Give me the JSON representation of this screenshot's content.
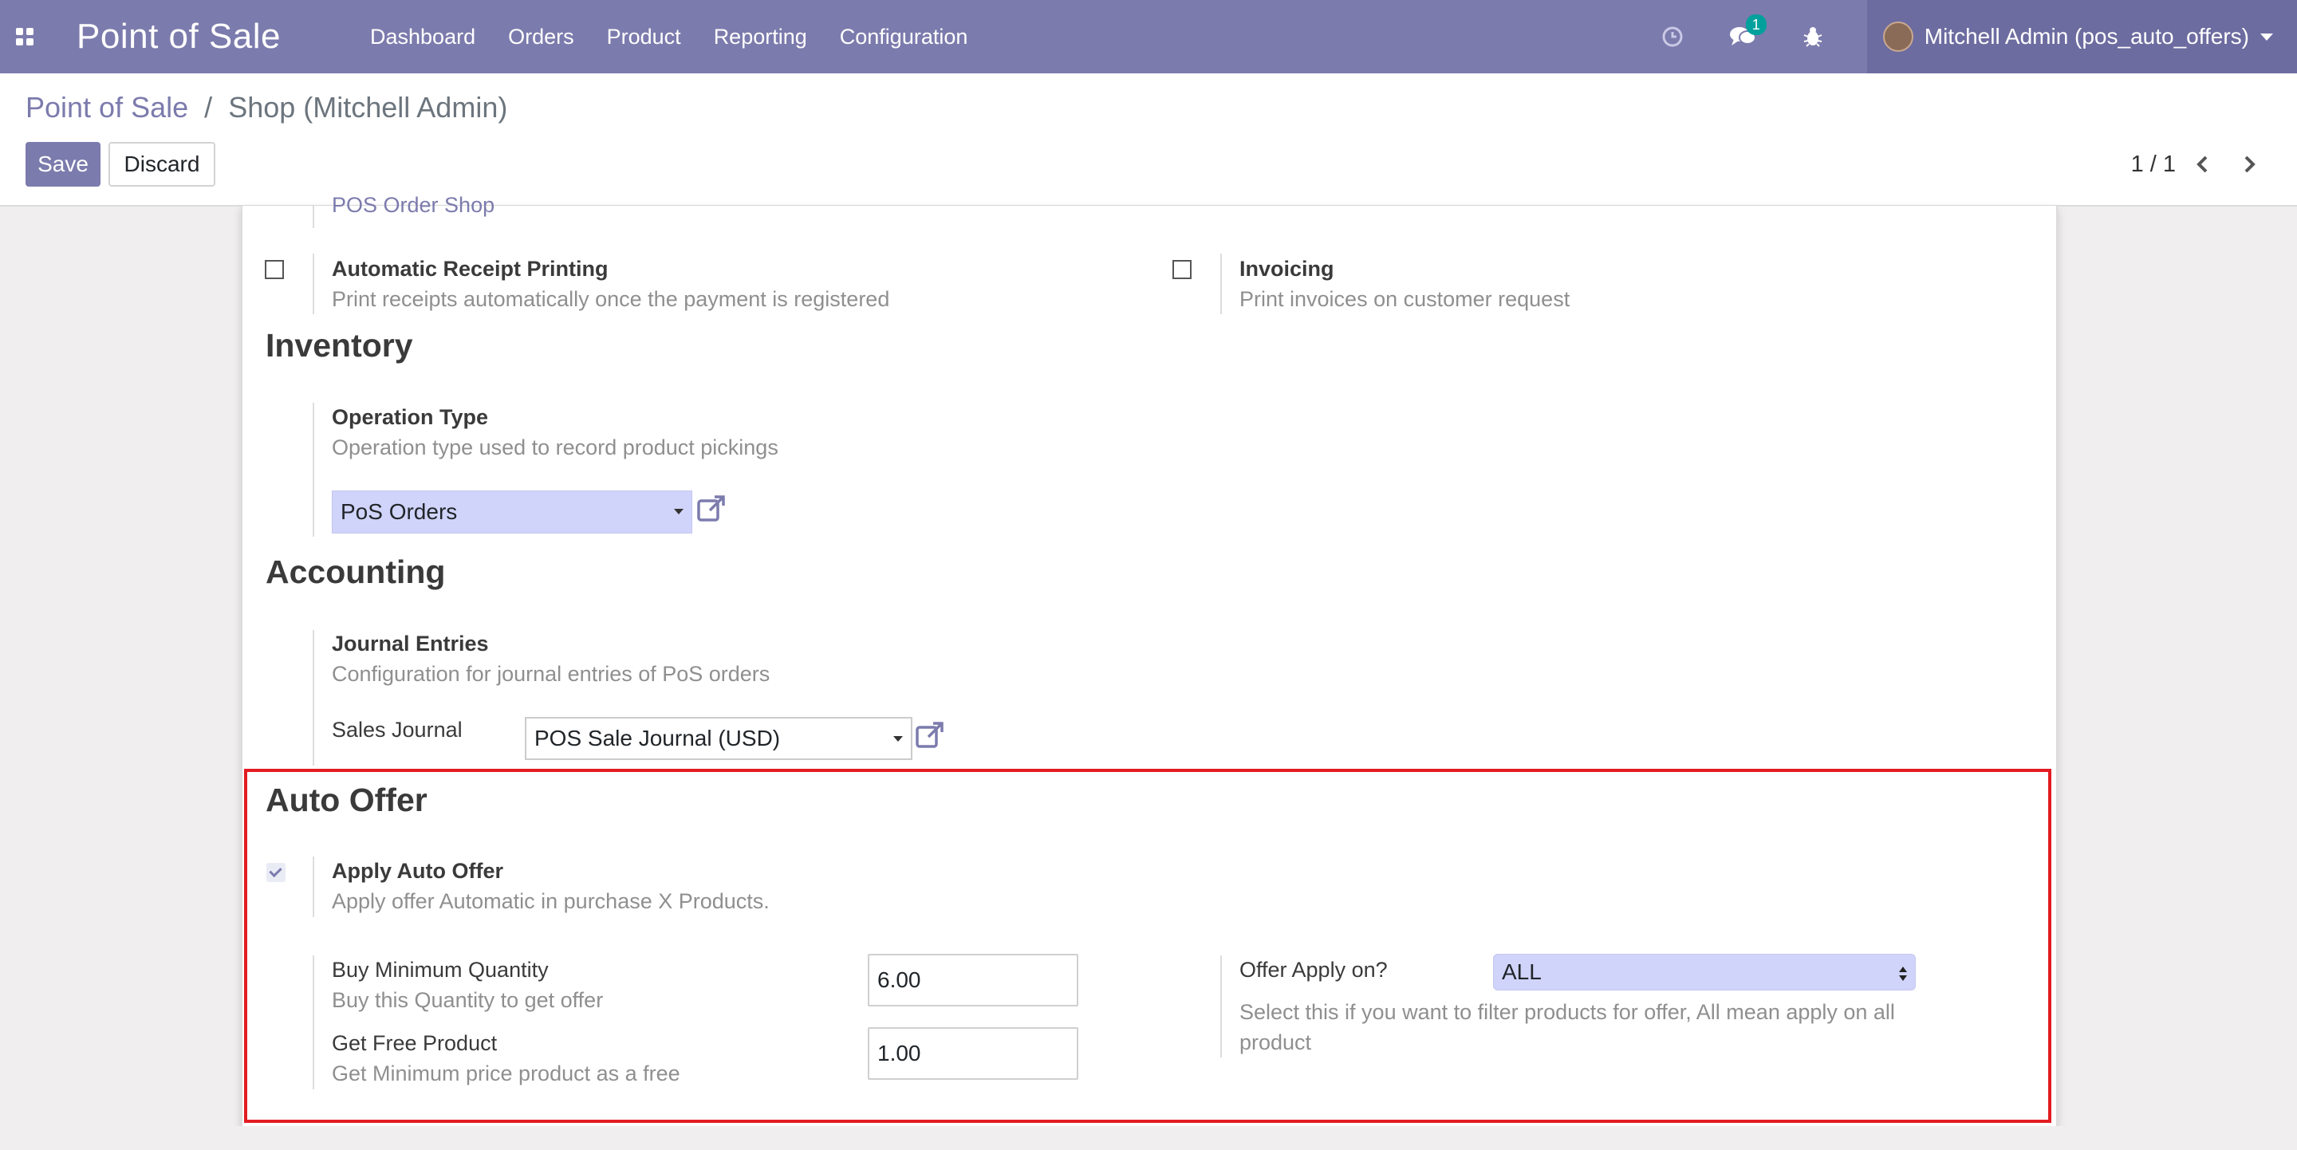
{
  "navbar": {
    "brand": "Point of Sale",
    "menu": [
      "Dashboard",
      "Orders",
      "Product",
      "Reporting",
      "Configuration"
    ],
    "messages_badge": "1",
    "user": "Mitchell Admin (pos_auto_offers)",
    "bg_color": "#7c7bad"
  },
  "breadcrumb": {
    "root": "Point of Sale",
    "separator": "/",
    "current": "Shop (Mitchell Admin)"
  },
  "buttons": {
    "save": "Save",
    "discard": "Discard"
  },
  "pager": "1 / 1",
  "top_cut": {
    "link": "POS Order Shop"
  },
  "receipt": {
    "auto_print_label": "Automatic Receipt Printing",
    "auto_print_help": "Print receipts automatically once the payment is registered",
    "invoicing_label": "Invoicing",
    "invoicing_help": "Print invoices on customer request"
  },
  "inventory": {
    "title": "Inventory",
    "op_type_label": "Operation Type",
    "op_type_help": "Operation type used to record product pickings",
    "op_type_value": "PoS Orders"
  },
  "accounting": {
    "title": "Accounting",
    "journal_label": "Journal Entries",
    "journal_help": "Configuration for journal entries of PoS orders",
    "sales_journal_label": "Sales Journal",
    "sales_journal_value": "POS Sale Journal (USD)"
  },
  "auto_offer": {
    "title": "Auto Offer",
    "apply_label": "Apply Auto Offer",
    "apply_help": "Apply offer Automatic in purchase X Products.",
    "apply_checked": true,
    "buy_min_label": "Buy Minimum Quantity",
    "buy_min_help": "Buy this Quantity to get offer",
    "buy_min_value": "6.00",
    "free_label": "Get Free Product",
    "free_help": "Get Minimum price product as a free",
    "free_value": "1.00",
    "apply_on_label": "Offer Apply on?",
    "apply_on_value": "ALL",
    "apply_on_help_line1": "Select this if you want to filter products for offer, All mean apply on all",
    "apply_on_help_line2": "product"
  }
}
